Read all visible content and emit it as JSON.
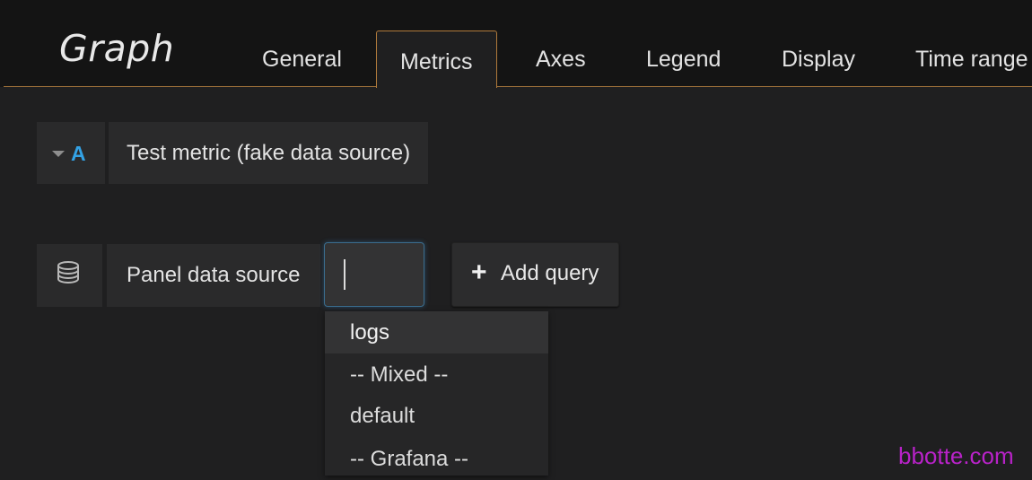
{
  "header": {
    "title": "Graph",
    "tabs": [
      {
        "label": "General"
      },
      {
        "label": "Metrics"
      },
      {
        "label": "Axes"
      },
      {
        "label": "Legend"
      },
      {
        "label": "Display"
      },
      {
        "label": "Time range"
      }
    ],
    "active_tab": "Metrics",
    "accent_color": "#b07a3b"
  },
  "query": {
    "ref_id": "A",
    "ref_id_color": "#33a2e5",
    "label": "Test metric (fake data source)"
  },
  "datasource": {
    "label": "Panel data source",
    "input_value": "",
    "add_query_label": "Add query",
    "options": [
      "logs",
      "-- Mixed --",
      "default",
      "-- Grafana --"
    ],
    "highlighted_option": "logs"
  },
  "watermark": "bbotte.com"
}
